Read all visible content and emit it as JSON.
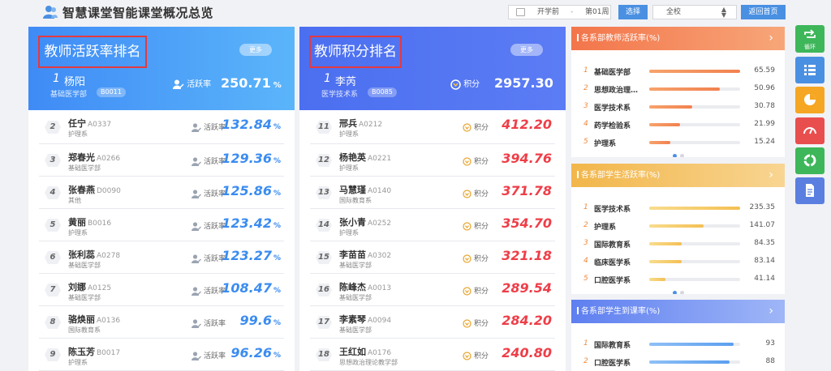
{
  "header": {
    "title": "智慧课堂智能课堂概况总览",
    "term": "开学前",
    "week_separator": "-",
    "week": "第01周",
    "select_label": "选择",
    "school": "全校",
    "home_label": "返回首页"
  },
  "teacher_panel": {
    "title": "教师活跃率排名",
    "more_label": "更多",
    "top": {
      "rank": "1",
      "name": "杨阳",
      "dept": "基础医学部",
      "code": "B0011",
      "metric_label": "活跃率",
      "value": "250.71",
      "unit": "%"
    },
    "rows": [
      {
        "rank": "2",
        "name": "任宁",
        "code": "A0337",
        "dept": "护理系",
        "metric_label": "活跃率",
        "value": "132.84",
        "unit": "%"
      },
      {
        "rank": "3",
        "name": "郑春光",
        "code": "A0266",
        "dept": "基础医学部",
        "metric_label": "活跃率",
        "value": "129.36",
        "unit": "%"
      },
      {
        "rank": "4",
        "name": "张春燕",
        "code": "D0090",
        "dept": "其他",
        "metric_label": "活跃率",
        "value": "125.86",
        "unit": "%"
      },
      {
        "rank": "5",
        "name": "黄丽",
        "code": "B0016",
        "dept": "护理系",
        "metric_label": "活跃率",
        "value": "123.42",
        "unit": "%"
      },
      {
        "rank": "6",
        "name": "张利蕊",
        "code": "A0278",
        "dept": "基础医学部",
        "metric_label": "活跃率",
        "value": "123.27",
        "unit": "%"
      },
      {
        "rank": "7",
        "name": "刘娜",
        "code": "A0125",
        "dept": "基础医学部",
        "metric_label": "活跃率",
        "value": "108.47",
        "unit": "%"
      },
      {
        "rank": "8",
        "name": "骆焕丽",
        "code": "A0136",
        "dept": "国际教育系",
        "metric_label": "活跃率",
        "value": "99.6",
        "unit": "%"
      },
      {
        "rank": "9",
        "name": "陈玉芳",
        "code": "B0017",
        "dept": "护理系",
        "metric_label": "活跃率",
        "value": "96.26",
        "unit": "%"
      }
    ]
  },
  "points_panel": {
    "title": "教师积分排名",
    "more_label": "更多",
    "top": {
      "rank": "1",
      "name": "李芮",
      "dept": "医学技术系",
      "code": "B0085",
      "metric_label": "积分",
      "value": "2957.30"
    },
    "rows": [
      {
        "rank": "11",
        "name": "邢兵",
        "code": "A0212",
        "dept": "护理系",
        "metric_label": "积分",
        "value": "412.20"
      },
      {
        "rank": "12",
        "name": "杨艳英",
        "code": "A0221",
        "dept": "护理系",
        "metric_label": "积分",
        "value": "394.76"
      },
      {
        "rank": "13",
        "name": "马慧瑾",
        "code": "A0140",
        "dept": "国际教育系",
        "metric_label": "积分",
        "value": "371.78"
      },
      {
        "rank": "14",
        "name": "张小青",
        "code": "A0252",
        "dept": "护理系",
        "metric_label": "积分",
        "value": "354.70"
      },
      {
        "rank": "15",
        "name": "李苗苗",
        "code": "A0302",
        "dept": "基础医学部",
        "metric_label": "积分",
        "value": "321.18"
      },
      {
        "rank": "16",
        "name": "陈峰杰",
        "code": "A0013",
        "dept": "基础医学部",
        "metric_label": "积分",
        "value": "289.54"
      },
      {
        "rank": "17",
        "name": "李素琴",
        "code": "A0094",
        "dept": "基础医学部",
        "metric_label": "积分",
        "value": "284.20"
      },
      {
        "rank": "18",
        "name": "王红如",
        "code": "A0176",
        "dept": "思想政治理论教学部",
        "metric_label": "积分",
        "value": "240.80"
      }
    ]
  },
  "cards": [
    {
      "title": "各系部教师活跃率(%)",
      "max": 65.59,
      "items": [
        {
          "n": "1",
          "label": "基础医学部",
          "value": "65.59"
        },
        {
          "n": "2",
          "label": "思想政治理…",
          "value": "50.96"
        },
        {
          "n": "3",
          "label": "医学技术系",
          "value": "30.78"
        },
        {
          "n": "4",
          "label": "药学检验系",
          "value": "21.99"
        },
        {
          "n": "5",
          "label": "护理系",
          "value": "15.24"
        }
      ]
    },
    {
      "title": "各系部学生活跃率(%)",
      "max": 235.35,
      "items": [
        {
          "n": "1",
          "label": "医学技术系",
          "value": "235.35"
        },
        {
          "n": "2",
          "label": "护理系",
          "value": "141.07"
        },
        {
          "n": "3",
          "label": "国际教育系",
          "value": "84.35"
        },
        {
          "n": "4",
          "label": "临床医学系",
          "value": "83.14"
        },
        {
          "n": "5",
          "label": "口腔医学系",
          "value": "41.14"
        }
      ]
    },
    {
      "title": "各系部学生到课率(%)",
      "max": 100,
      "items": [
        {
          "n": "1",
          "label": "国际教育系",
          "value": "93"
        },
        {
          "n": "2",
          "label": "口腔医学系",
          "value": "88"
        }
      ]
    }
  ],
  "side_toolbar": {
    "loop_label": "循环",
    "icons": [
      "loop-icon",
      "list-icon",
      "pie-chart-icon",
      "gauge-icon",
      "ring-icon",
      "document-icon"
    ]
  },
  "colors": {
    "accent": "#4a90e2",
    "rate_value": "#3b8cf0",
    "points_value": "#ee3e48",
    "card1": "#f3754a",
    "card2": "#f2b64a",
    "card3": "#5e7ff0"
  }
}
